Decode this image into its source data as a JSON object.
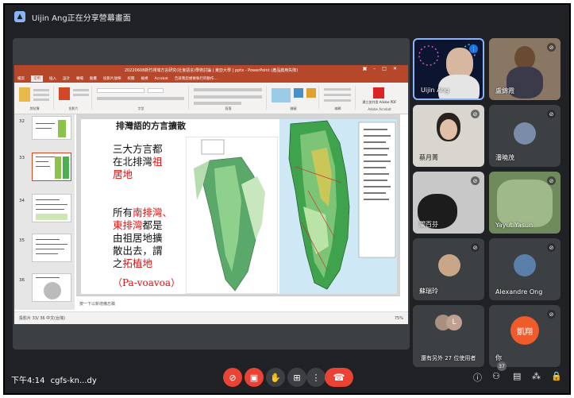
{
  "presenter_bar": {
    "text": "Uijin Ang正在分享營幕畫面"
  },
  "powerpoint": {
    "title": "20220608新竹排灣方言研究(社會語言)學術討論 | 東亞大學 | pptx - PowerPoint (產品啟用失敗)",
    "tabs": [
      "檔案",
      "常用",
      "插入",
      "設計",
      "轉場",
      "動畫",
      "投影片放映",
      "校閱",
      "檢視",
      "Acrobat",
      "告訴我您想要執行的動作..."
    ],
    "ribbon_groups": [
      "剪貼簿",
      "投影片",
      "字型",
      "段落",
      "繪圖",
      "編輯",
      "Adobe Acrobat"
    ],
    "acrobat_button": "建立並共用 Adobe PDF",
    "thumbnail_numbers": [
      "33",
      "34",
      "35",
      "36"
    ],
    "slide": {
      "heading": "排灣語的方言擴散",
      "block1": [
        "三大方言都",
        "在北排灣",
        "居地"
      ],
      "block1_red": [
        "祖",
        ""
      ],
      "block2": [
        "所有",
        "東排灣",
        "由祖居地擴",
        "散出去，謂",
        "之"
      ],
      "block2_red": [
        "南排灣、",
        "都是",
        "拓植地"
      ],
      "pv": "（Pa-voavoa）"
    },
    "notes": "按一下以新增備忘稿",
    "status_left": "投影片 33/ 36  中文(台灣)",
    "status_right": "75%"
  },
  "participants": [
    {
      "name": "Uijin Ang",
      "muted": false
    },
    {
      "name": "盧錦霞",
      "muted": true
    },
    {
      "name": "蔡月菁",
      "muted": true
    },
    {
      "name": "潘曉茂",
      "muted": true
    },
    {
      "name": "關百芬",
      "muted": true
    },
    {
      "name": "Yayut Yasun",
      "muted": true
    },
    {
      "name": "蘇瑞玲",
      "muted": true
    },
    {
      "name": "Alexandre Ong",
      "muted": true
    },
    {
      "name": "還有另外 27 位使用者",
      "muted": false
    },
    {
      "name": "你",
      "muted": true
    }
  ],
  "self_avatar_text": "凱翔",
  "others_avatar_letter": "L",
  "bottom_bar": {
    "clock": "下午4:14",
    "meeting_code": "cgfs-kn...dy",
    "participant_count": "37"
  },
  "colors": {
    "meet_bg": "#202124",
    "ppt_accent": "#b7472a",
    "danger": "#ea4335",
    "slide_red": "#dd1111"
  }
}
